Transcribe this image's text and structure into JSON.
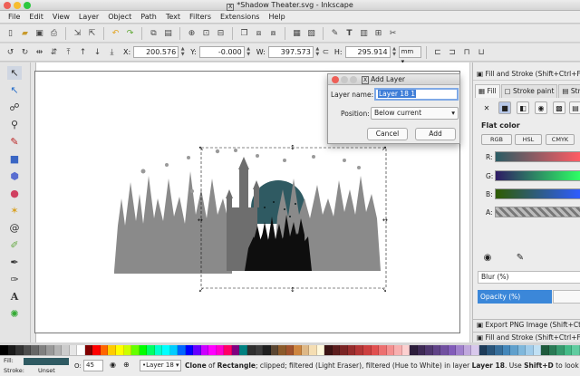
{
  "window": {
    "title": "*Shadow Theater.svg - Inkscape"
  },
  "menubar": [
    "File",
    "Edit",
    "View",
    "Layer",
    "Object",
    "Path",
    "Text",
    "Filters",
    "Extensions",
    "Help"
  ],
  "command_icons": [
    "new-document-icon",
    "open-icon",
    "save-icon",
    "print-icon",
    "import-icon",
    "export-icon",
    "undo-icon",
    "redo-icon",
    "copy-icon",
    "paste-icon",
    "zoom-selection-icon",
    "zoom-drawing-icon",
    "zoom-page-icon",
    "duplicate-icon",
    "clone-icon",
    "unlink-clone-icon",
    "group-icon",
    "ungroup-icon",
    "fill-stroke-icon",
    "text-font-icon",
    "xml-editor-icon",
    "align-icon",
    "preferences-icon"
  ],
  "controls": {
    "x_label": "X:",
    "x_value": "200.576",
    "y_label": "Y:",
    "y_value": "-0.000",
    "w_label": "W:",
    "w_value": "397.573",
    "h_label": "H:",
    "h_value": "295.914",
    "unit": "mm"
  },
  "tools": [
    "selector-tool-icon",
    "node-tool-icon",
    "tweak-tool-icon",
    "zoom-tool-icon",
    "measure-tool-icon",
    "rectangle-tool-icon",
    "3d-box-tool-icon",
    "ellipse-tool-icon",
    "star-tool-icon",
    "spiral-tool-icon",
    "pencil-tool-icon",
    "pen-tool-icon",
    "calligraphy-tool-icon",
    "text-tool-icon",
    "spray-tool-icon"
  ],
  "dialog": {
    "title": "Add Layer",
    "name_label": "Layer name:",
    "name_value": "Layer 18 1",
    "position_label": "Position:",
    "position_value": "Below current",
    "cancel": "Cancel",
    "add": "Add"
  },
  "fill_stroke": {
    "panel_title": "Fill and Stroke (Shift+Ctrl+F)",
    "tab_fill": "Fill",
    "tab_stroke_paint": "Stroke paint",
    "tab_stroke_style": "Stroke",
    "flat_color": "Flat color",
    "modes": [
      "RGB",
      "HSL",
      "CMYK"
    ],
    "channels": [
      "R:",
      "G:",
      "B:",
      "A:"
    ],
    "blur": "Blur (%)",
    "opacity": "Opacity (%)",
    "export_panel": "Export PNG Image (Shift+Ctrl+E)",
    "fill_stroke_panel": "Fill and Stroke (Shift+Ctrl+F)"
  },
  "status": {
    "fill_label": "Fill:",
    "stroke_label": "Stroke:",
    "unset": "Unset",
    "opacity_label": "O:",
    "opacity_value": "45",
    "layer": "•Layer 18",
    "message_bold1": "Clone",
    "message_t1": " of ",
    "message_bold2": "Rectangle",
    "message_t2": "; clipped; filtered (Light Eraser), filtered (Hue to White) in layer ",
    "message_bold3": "Layer 18",
    "message_t3": ". Use ",
    "message_bold4": "Shift+D",
    "message_t4": " to look up original"
  },
  "palette": [
    "#000000",
    "#1a1a1a",
    "#333333",
    "#4d4d4d",
    "#666666",
    "#808080",
    "#999999",
    "#b3b3b3",
    "#cccccc",
    "#e6e6e6",
    "#ffffff",
    "#800000",
    "#ff0000",
    "#ff6600",
    "#ffcc00",
    "#ffff00",
    "#ccff00",
    "#66ff00",
    "#00ff00",
    "#00ff66",
    "#00ffcc",
    "#00ffff",
    "#00ccff",
    "#0066ff",
    "#0000ff",
    "#6600ff",
    "#cc00ff",
    "#ff00ff",
    "#ff00cc",
    "#ff0066",
    "#800080",
    "#008080",
    "#2f2f2f",
    "#3b3b3b",
    "#1f1f1f",
    "#5a4632",
    "#8b5a2b",
    "#a0522d",
    "#cd853f",
    "#deb887",
    "#f5deb3",
    "#fff8dc",
    "#3c1414",
    "#5c1e1e",
    "#7a2424",
    "#962d2d",
    "#b33636",
    "#cc4040",
    "#e05050",
    "#ec7070",
    "#f49090",
    "#f8b0b0",
    "#fcd0d0",
    "#2d1e3c",
    "#3e2a55",
    "#4f376e",
    "#604387",
    "#7150a0",
    "#825cb9",
    "#a080cc",
    "#c0a8dd",
    "#d8c8ec",
    "#1e3c5a",
    "#2a557a",
    "#376e9a",
    "#4487ba",
    "#60a0cc",
    "#80b8dc",
    "#a0ccea",
    "#c0e0f4",
    "#1e5a3c",
    "#2a7a55",
    "#379a6e",
    "#44ba87",
    "#60cca0"
  ],
  "scene_lettering": []
}
